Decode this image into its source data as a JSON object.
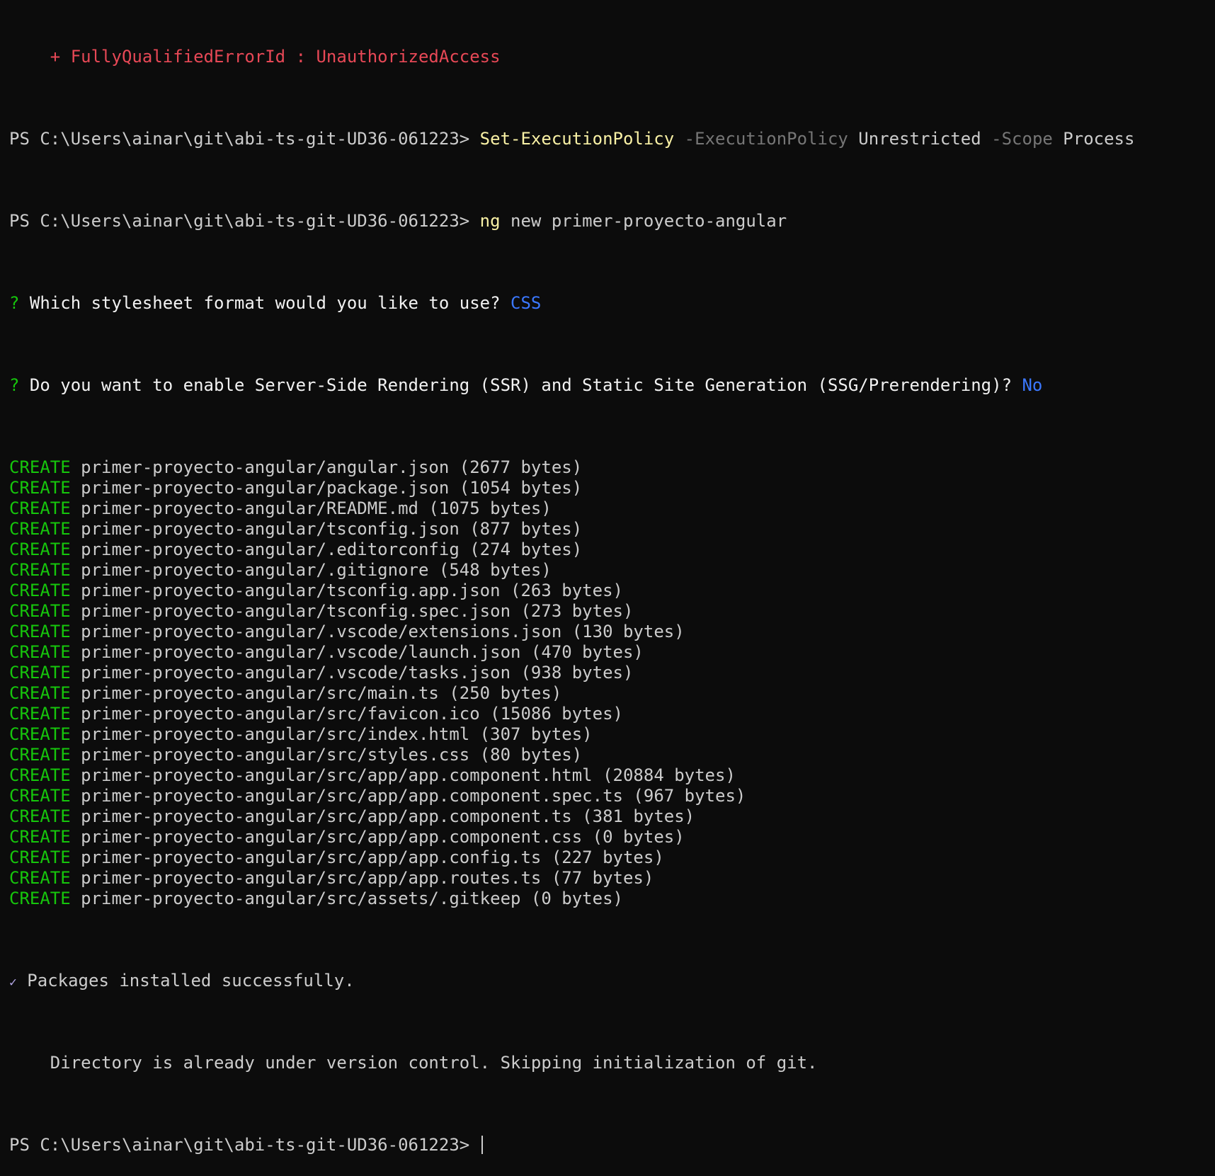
{
  "error_line": {
    "indent": "    ",
    "text": "+ FullyQualifiedErrorId : UnauthorizedAccess"
  },
  "prompt": "PS C:\\Users\\ainar\\git\\abi-ts-git-UD36-061223> ",
  "commands": [
    {
      "cmd": "Set-ExecutionPolicy",
      "parts": [
        {
          "text": " -ExecutionPolicy",
          "style": "param"
        },
        {
          "text": " Unrestricted",
          "style": "arg"
        },
        {
          "text": " -Scope",
          "style": "param"
        },
        {
          "text": " Process",
          "style": "arg"
        }
      ]
    },
    {
      "cmd": "ng",
      "parts": [
        {
          "text": " new primer-proyecto-angular",
          "style": "arg"
        }
      ]
    }
  ],
  "questions": [
    {
      "mark": "?",
      "text": " Which stylesheet format would you like to use? ",
      "answer": "CSS"
    },
    {
      "mark": "?",
      "text": " Do you want to enable Server-Side Rendering (SSR) and Static Site Generation (SSG/Prerendering)? ",
      "answer": "No"
    }
  ],
  "create_label": "CREATE",
  "created_files": [
    "primer-proyecto-angular/angular.json (2677 bytes)",
    "primer-proyecto-angular/package.json (1054 bytes)",
    "primer-proyecto-angular/README.md (1075 bytes)",
    "primer-proyecto-angular/tsconfig.json (877 bytes)",
    "primer-proyecto-angular/.editorconfig (274 bytes)",
    "primer-proyecto-angular/.gitignore (548 bytes)",
    "primer-proyecto-angular/tsconfig.app.json (263 bytes)",
    "primer-proyecto-angular/tsconfig.spec.json (273 bytes)",
    "primer-proyecto-angular/.vscode/extensions.json (130 bytes)",
    "primer-proyecto-angular/.vscode/launch.json (470 bytes)",
    "primer-proyecto-angular/.vscode/tasks.json (938 bytes)",
    "primer-proyecto-angular/src/main.ts (250 bytes)",
    "primer-proyecto-angular/src/favicon.ico (15086 bytes)",
    "primer-proyecto-angular/src/index.html (307 bytes)",
    "primer-proyecto-angular/src/styles.css (80 bytes)",
    "primer-proyecto-angular/src/app/app.component.html (20884 bytes)",
    "primer-proyecto-angular/src/app/app.component.spec.ts (967 bytes)",
    "primer-proyecto-angular/src/app/app.component.ts (381 bytes)",
    "primer-proyecto-angular/src/app/app.component.css (0 bytes)",
    "primer-proyecto-angular/src/app/app.config.ts (227 bytes)",
    "primer-proyecto-angular/src/app/app.routes.ts (77 bytes)",
    "primer-proyecto-angular/src/assets/.gitkeep (0 bytes)"
  ],
  "success": {
    "mark": "✓",
    "text": " Packages installed successfully."
  },
  "git_message": "    Directory is already under version control. Skipping initialization of git.",
  "colors": {
    "background": "#0c0c0c",
    "foreground": "#cccccc",
    "error": "#e74856",
    "command": "#f9f1a5",
    "parameter": "#767676",
    "create": "#16c60c",
    "answer": "#3b78ff",
    "question_mark": "#16c60c"
  }
}
